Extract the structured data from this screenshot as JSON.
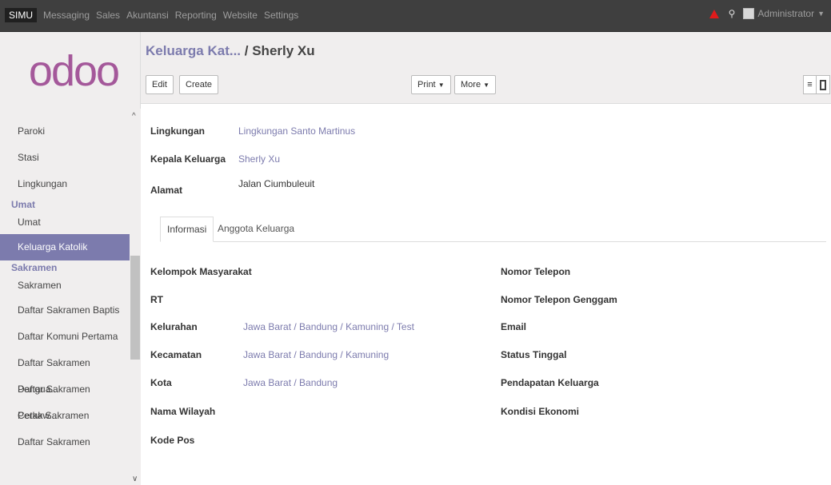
{
  "topbar": {
    "menu": [
      "SIMU",
      "Messaging",
      "Sales",
      "Akuntansi",
      "Reporting",
      "Website",
      "Settings"
    ],
    "user": "Administrator"
  },
  "sidebar": {
    "logo": "odoo",
    "items": [
      {
        "type": "item",
        "label": "Paroki"
      },
      {
        "type": "item",
        "label": "Stasi"
      },
      {
        "type": "item",
        "label": "Lingkungan"
      },
      {
        "type": "header",
        "label": "Umat"
      },
      {
        "type": "item",
        "label": "Umat"
      },
      {
        "type": "item",
        "label": "Keluarga Katolik",
        "active": true
      },
      {
        "type": "header",
        "label": "Sakramen"
      },
      {
        "type": "item",
        "label": "Sakramen"
      },
      {
        "type": "item",
        "label": "Daftar Sakramen Baptis"
      },
      {
        "type": "item",
        "label": "Daftar Komuni Pertama"
      },
      {
        "type": "item",
        "label": "Daftar Sakramen Pengua..."
      },
      {
        "type": "item",
        "label": "Daftar Sakramen Perkaw..."
      },
      {
        "type": "item",
        "label": "Cetak Sakramen"
      },
      {
        "type": "item",
        "label": "Daftar Sakramen"
      }
    ]
  },
  "breadcrumb": {
    "parent": "Keluarga Kat...",
    "separator": " / ",
    "current": "Sherly Xu"
  },
  "buttons": {
    "edit": "Edit",
    "create": "Create",
    "print": "Print",
    "more": "More"
  },
  "header_fields": [
    {
      "label": "Lingkungan",
      "value": "Lingkungan Santo Martinus",
      "link": true
    },
    {
      "label": "Kepala Keluarga",
      "value": "Sherly Xu",
      "link": true
    },
    {
      "label": "Alamat",
      "value": "Jalan Ciumbuleuit",
      "link": false
    }
  ],
  "tabs": [
    "Informasi",
    "Anggota Keluarga"
  ],
  "left_fields": [
    {
      "label": "Kelompok Masyarakat",
      "value": ""
    },
    {
      "label": "RT",
      "value": ""
    },
    {
      "label": "Kelurahan",
      "value": "Jawa Barat / Bandung / Kamuning / Test"
    },
    {
      "label": "Kecamatan",
      "value": "Jawa Barat / Bandung / Kamuning"
    },
    {
      "label": "Kota",
      "value": "Jawa Barat / Bandung"
    },
    {
      "label": "Nama Wilayah",
      "value": ""
    },
    {
      "label": "Kode Pos",
      "value": ""
    }
  ],
  "right_fields": [
    {
      "label": "Nomor Telepon",
      "value": ""
    },
    {
      "label": "Nomor Telepon Genggam",
      "value": ""
    },
    {
      "label": "Email",
      "value": ""
    },
    {
      "label": "Status Tinggal",
      "value": ""
    },
    {
      "label": "Pendapatan Keluarga",
      "value": ""
    },
    {
      "label": "Kondisi Ekonomi",
      "value": ""
    }
  ],
  "colors": {
    "accent": "#7c7bad",
    "topbar": "#3f3f3f",
    "sidebar_bg": "#f0eeee",
    "alert": "#e01b1b"
  },
  "icons": [
    "alert-icon",
    "chat-icon",
    "avatar-icon",
    "list-view-icon",
    "form-view-icon",
    "scroll-up-icon",
    "scroll-down-icon"
  ]
}
